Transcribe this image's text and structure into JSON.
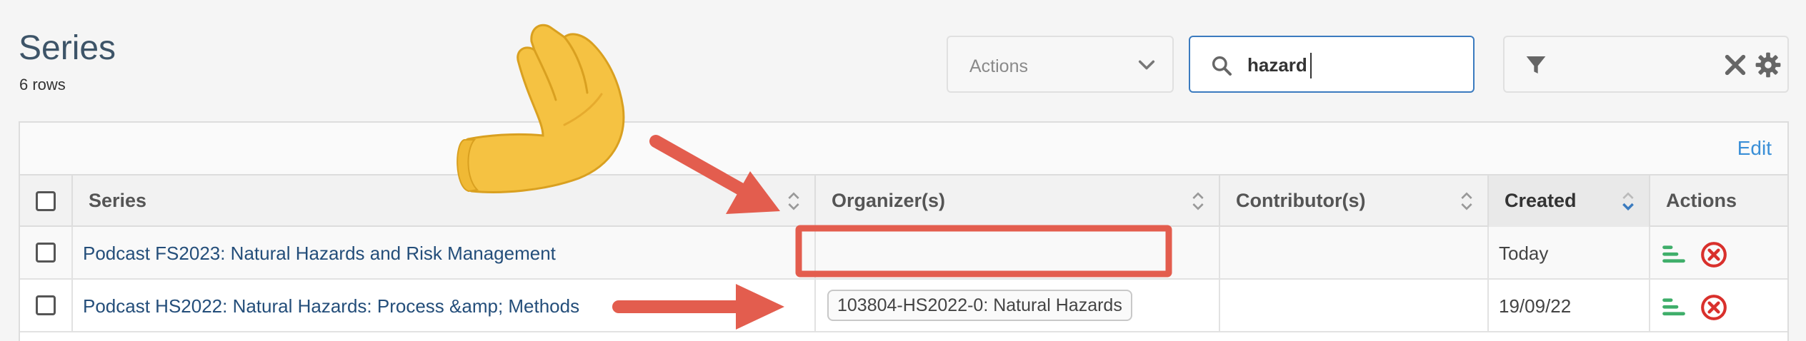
{
  "header": {
    "title": "Series",
    "row_count": "6 rows"
  },
  "actions_select": {
    "label": "Actions",
    "icon": "chevron-down-icon"
  },
  "search": {
    "value": "hazard",
    "icon": "search-icon"
  },
  "filter": {
    "icons": [
      "filter-icon",
      "clear-icon",
      "gear-icon"
    ]
  },
  "toolbar": {
    "edit_label": "Edit"
  },
  "table": {
    "columns": [
      "Series",
      "Organizer(s)",
      "Contributor(s)",
      "Created",
      "Actions"
    ],
    "rows": [
      {
        "series": "Podcast FS2023: Natural Hazards and Risk Management",
        "organizer": "",
        "contributor": "",
        "created": "Today"
      },
      {
        "series": "Podcast HS2022: Natural Hazards: Process &amp; Methods",
        "organizer": "103804-HS2022-0: Natural Hazards",
        "contributor": "",
        "created": "19/09/22"
      }
    ]
  },
  "colors": {
    "accent": "#3b7bbf",
    "link": "#244e7a",
    "annotation": "#e35d4e",
    "stats": "#3fae6a",
    "delete": "#d9302c"
  },
  "annotations": {
    "emoji": "pinched-fingers",
    "highlight_box": "organizer-cell-row-1"
  }
}
